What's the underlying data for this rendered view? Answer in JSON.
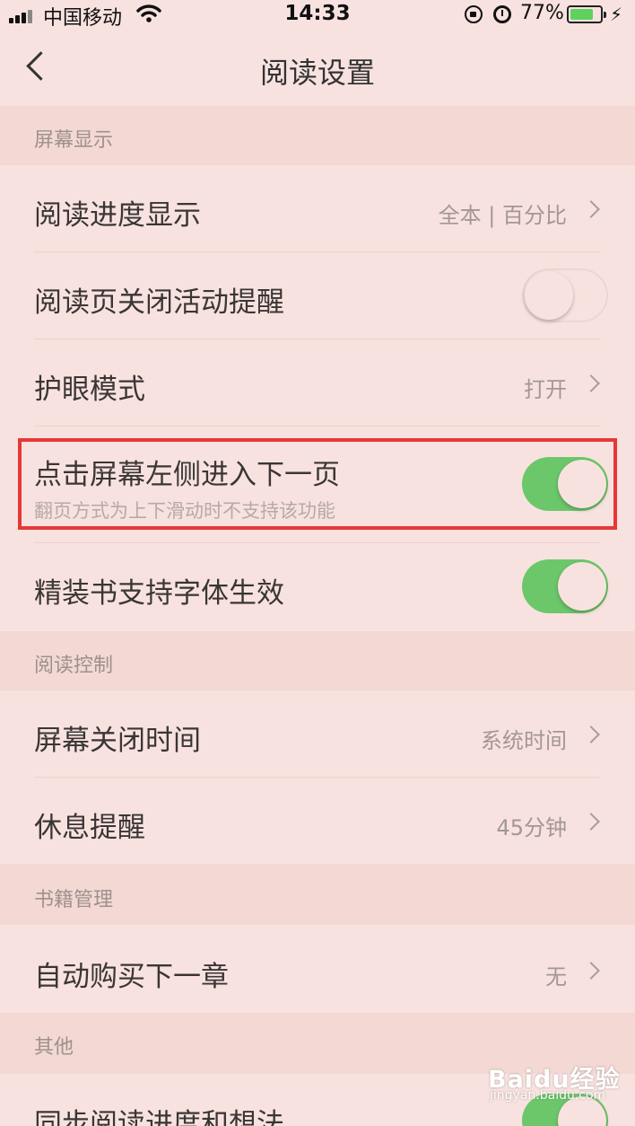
{
  "status_bar": {
    "carrier": "中国移动",
    "time": "14:33",
    "battery_percent": "77%",
    "battery_level": 0.77,
    "icons": [
      "signal-icon",
      "wifi-icon",
      "orientation-lock-icon",
      "alarm-icon",
      "battery-icon",
      "charging-icon"
    ]
  },
  "nav": {
    "title": "阅读设置",
    "back_icon": "chevron-left-icon"
  },
  "sections": {
    "screen_display": "屏幕显示",
    "reading_control": "阅读控制",
    "book_management": "书籍管理",
    "other": "其他"
  },
  "rows": {
    "progress_display": {
      "label": "阅读进度显示",
      "value": "全本 | 百分比"
    },
    "close_activity_reminder": {
      "label": "阅读页关闭活动提醒",
      "toggle": false
    },
    "eye_protection": {
      "label": "护眼模式",
      "value": "打开"
    },
    "tap_left_next_page": {
      "label": "点击屏幕左侧进入下一页",
      "sublabel": "翻页方式为上下滑动时不支持该功能",
      "toggle": true
    },
    "hardcover_font": {
      "label": "精装书支持字体生效",
      "toggle": true
    },
    "screen_off_time": {
      "label": "屏幕关闭时间",
      "value": "系统时间"
    },
    "rest_reminder": {
      "label": "休息提醒",
      "value": "45分钟"
    },
    "auto_buy_next": {
      "label": "自动购买下一章",
      "value": "无"
    },
    "sync_progress": {
      "label": "同步阅读进度和想法",
      "toggle": true
    }
  },
  "colors": {
    "background": "#f8e2df",
    "section_background": "#f3d8d4",
    "toggle_on": "#6cc76a",
    "highlight_border": "#e63737"
  },
  "watermark": {
    "brand": "Baidu经验",
    "url": "jingyan.baidu.com"
  }
}
